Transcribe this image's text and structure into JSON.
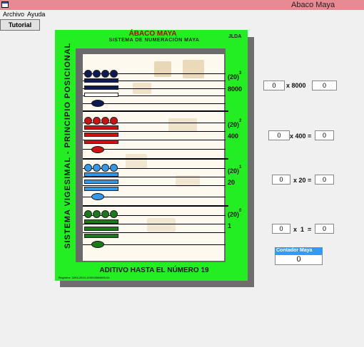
{
  "window": {
    "title": "Abaco Maya"
  },
  "menu": {
    "archivo": "Archivo",
    "ayuda": "Ayuda"
  },
  "toolbar": {
    "tutorial": "Tutorial"
  },
  "board": {
    "title": "ÁBACO MAYA",
    "subtitle": "SISTEMA DE NUMERACIÓN MAYA",
    "initials": "JLDA",
    "vertical_label": "SISTEMA VIGESIMAL - PRINCIPIO POSICIONAL",
    "bottom_label": "ADITIVO HASTA EL NÚMERO 19",
    "registry": "Registro: 2203-2013-120013864900-01"
  },
  "levels": [
    {
      "base": "(20)",
      "exp": "3",
      "value": "8000",
      "bead_color": "#0d1a52",
      "bar_color": "#0d1a52",
      "shell_color": "#0d1a52"
    },
    {
      "base": "(20)",
      "exp": "2",
      "value": "400",
      "bead_color": "#cc1111",
      "bar_color": "#cc1111",
      "shell_color": "#cc1111"
    },
    {
      "base": "(20)",
      "exp": "1",
      "value": "20",
      "bead_color": "#3399e6",
      "bar_color": "#3399e6",
      "shell_color": "#3399e6"
    },
    {
      "base": "(20)",
      "exp": "0",
      "value": "1",
      "bead_color": "#1a7a1a",
      "bar_color": "#1a7a1a",
      "shell_color": "#1a7a1a"
    }
  ],
  "calculator": [
    {
      "input": "0",
      "multiplier": "x 8000",
      "result": "0"
    },
    {
      "input": "0",
      "multiplier": "x 400 =",
      "result": "0"
    },
    {
      "input": "0",
      "multiplier": "x 20 =",
      "result": "0"
    },
    {
      "input": "0",
      "multiplier": "x  1  =",
      "result": "0"
    }
  ],
  "counter": {
    "label": "Contador Maya",
    "value": "0"
  },
  "colors": {
    "board_green": "#22ee22",
    "frame_gray": "#6a6a6a",
    "title_red": "#c00000",
    "titlebar": "#e88a93",
    "counter_blue": "#3399ff"
  }
}
